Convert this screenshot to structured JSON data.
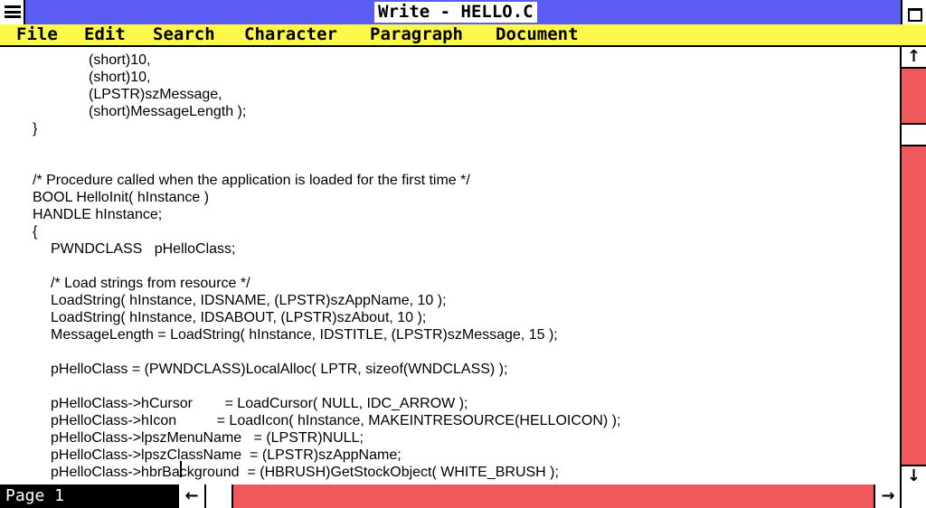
{
  "window": {
    "title": "Write - HELLO.C"
  },
  "menu": {
    "items": [
      "File",
      "Edit",
      "Search",
      "Character",
      "Paragraph",
      "Document"
    ]
  },
  "document": {
    "lines": [
      "(short)10,",
      "(short)10,",
      "(LPSTR)szMessage,",
      "(short)MessageLength );",
      "}",
      "",
      "",
      "/* Procedure called when the application is loaded for the first time */",
      "BOOL HelloInit( hInstance )",
      "HANDLE hInstance;",
      "{",
      "PWNDCLASS   pHelloClass;",
      "",
      "/* Load strings from resource */",
      "LoadString( hInstance, IDSNAME, (LPSTR)szAppName, 10 );",
      "LoadString( hInstance, IDSABOUT, (LPSTR)szAbout, 10 );",
      "MessageLength = LoadString( hInstance, IDSTITLE, (LPSTR)szMessage, 15 );",
      "",
      "pHelloClass = (PWNDCLASS)LocalAlloc( LPTR, sizeof(WNDCLASS) );",
      "",
      "pHelloClass->hCursor        = LoadCursor( NULL, IDC_ARROW );",
      "pHelloClass->hIcon          = LoadIcon( hInstance, MAKEINTRESOURCE(HELLOICON) );",
      "pHelloClass->lpszMenuName   = (LPSTR)NULL;",
      "pHelloClass->lpszClassName  = (LPSTR)szAppName;",
      "pHelloClass->hbrBackground  = (HBRUSH)GetStockObject( WHITE_BRUSH );"
    ]
  },
  "status": {
    "page_label": "Page 1"
  },
  "scrollbars": {
    "up_arrow": "↑",
    "down_arrow": "↓",
    "left_arrow": "←",
    "right_arrow": "→"
  },
  "colors": {
    "titlebar": "#5a5cf4",
    "menubar": "#fdf94a",
    "scrollbar": "#f0595b"
  },
  "icons": [
    "system-menu-icon",
    "maximize-icon",
    "scroll-up-arrow-icon",
    "scroll-down-arrow-icon",
    "scroll-left-arrow-icon",
    "scroll-right-arrow-icon"
  ]
}
